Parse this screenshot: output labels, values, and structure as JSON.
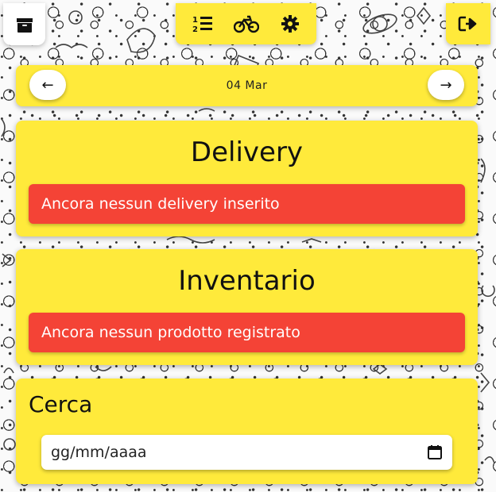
{
  "topbar": {
    "left_icon": "box-icon",
    "center_icons": [
      "ordered-list-icon",
      "bicycle-icon",
      "gear-icon"
    ],
    "right_icon": "logout-icon"
  },
  "date_nav": {
    "prev_label": "←",
    "date": "04 Mar",
    "next_label": "→"
  },
  "delivery": {
    "title": "Delivery",
    "empty_message": "Ancora nessun delivery inserito"
  },
  "inventory": {
    "title": "Inventario",
    "empty_message": "Ancora nessun prodotto registrato"
  },
  "search": {
    "title": "Cerca",
    "date_placeholder": "gg/mm/aaaa"
  },
  "colors": {
    "accent": "#ffea3b",
    "alert": "#f44336"
  }
}
